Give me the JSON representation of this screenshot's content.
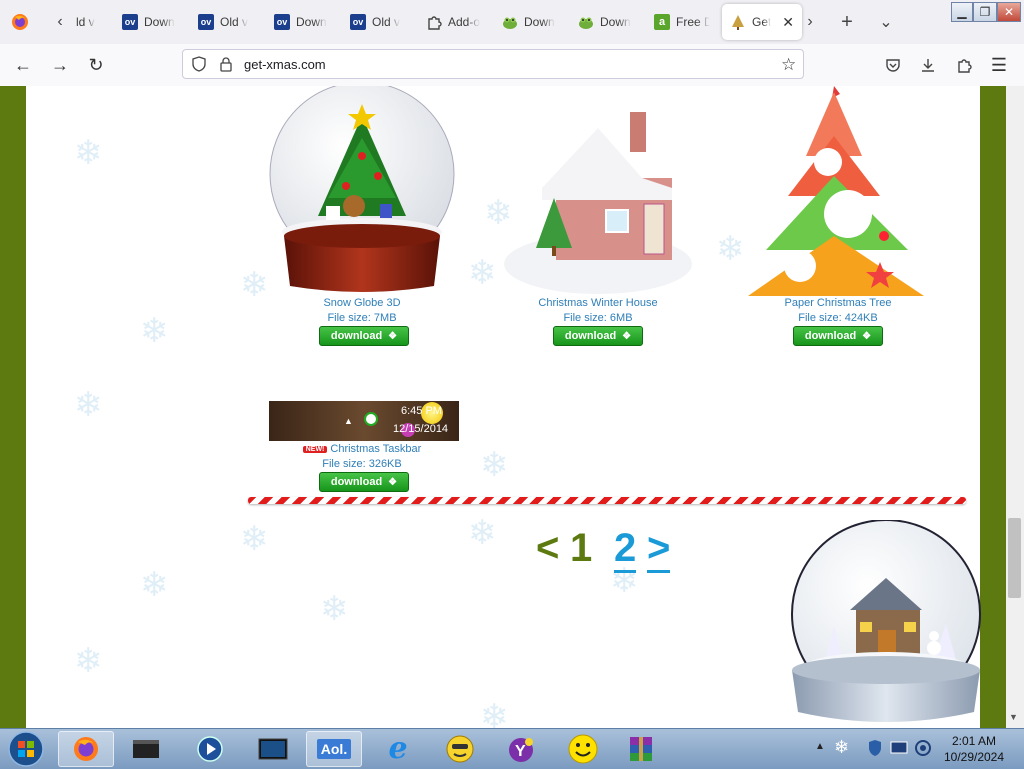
{
  "tabs": [
    {
      "title": "ld v"
    },
    {
      "title": "Down",
      "icon": "ov-icon"
    },
    {
      "title": "Old v",
      "icon": "ov-icon"
    },
    {
      "title": "Down",
      "icon": "ov-icon"
    },
    {
      "title": "Old v",
      "icon": "ov-icon"
    },
    {
      "title": "Add-o",
      "icon": "puzzle-icon"
    },
    {
      "title": "Down",
      "icon": "frog-icon"
    },
    {
      "title": "Down",
      "icon": "frog-icon"
    },
    {
      "title": "Free D",
      "icon": "a-icon",
      "icon_letter": "a"
    },
    {
      "title": "Get",
      "icon": "tree-icon",
      "active": true
    }
  ],
  "navbar": {
    "url": "get-xmas.com"
  },
  "products": [
    {
      "name": "Snow Globe 3D",
      "size": "File size: 7MB",
      "button": "download"
    },
    {
      "name": "Christmas Winter House",
      "size": "File size: 6MB",
      "button": "download"
    },
    {
      "name": "Paper Christmas Tree",
      "size": "File size: 424KB",
      "button": "download"
    },
    {
      "name": "Christmas Taskbar",
      "size": "File size: 326KB",
      "button": "download",
      "badge": "NEW!"
    }
  ],
  "taskbar_preview": {
    "time": "6:45 PM",
    "date": "12/15/2014"
  },
  "pagination": {
    "prev": "<",
    "current": "1",
    "next_page": "2",
    "next": ">"
  },
  "taskbar": {
    "aol_label": "Aol.",
    "clock_time": "2:01 AM",
    "clock_date": "10/29/2024"
  },
  "colors": {
    "accent_green": "#5c7a10",
    "link_blue": "#2f7fb8",
    "pager_current": "#5c7a10",
    "pager_link": "#1a9ad6",
    "download_green": "#17951b"
  }
}
